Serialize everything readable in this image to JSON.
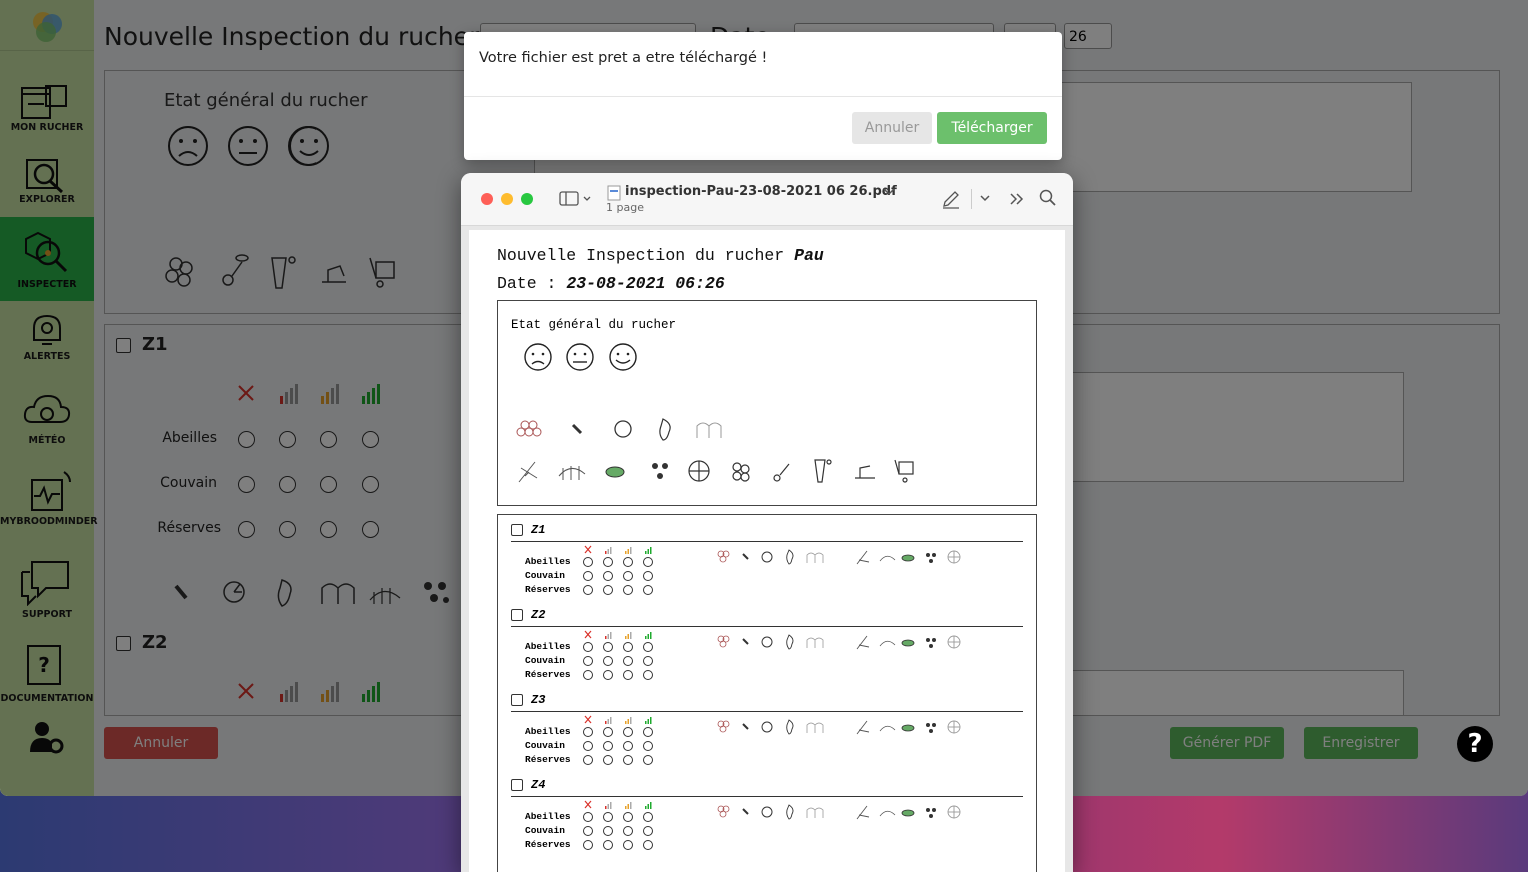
{
  "sidebar": {
    "items": [
      {
        "label": "MON RUCHER"
      },
      {
        "label": "EXPLORER"
      },
      {
        "label": "INSPECTER"
      },
      {
        "label": "ALERTES"
      },
      {
        "label": "MÉTÉO"
      },
      {
        "label": "MYBROODMINDER"
      },
      {
        "label": "SUPPORT"
      },
      {
        "label": "DOCUMENTATION"
      }
    ]
  },
  "header": {
    "title": "Nouvelle Inspection du rucher",
    "date_label": "Date",
    "minute_value": "26"
  },
  "etat": {
    "title": "Etat général du rucher"
  },
  "zones": [
    {
      "name": "Z1",
      "rows": [
        "Abeilles",
        "Couvain",
        "Réserves"
      ]
    },
    {
      "name": "Z2"
    }
  ],
  "footer": {
    "cancel": "Annuler",
    "generate_pdf": "Générer PDF",
    "save": "Enregistrer",
    "help": "?"
  },
  "modal": {
    "message": "Votre fichier est pret a etre téléchargé !",
    "cancel": "Annuler",
    "download": "Télécharger"
  },
  "pdf": {
    "filename": "inspection-Pau-23-08-2021 06 26.pdf",
    "pages": "1 page",
    "title_prefix": "Nouvelle Inspection du rucher",
    "apiary": "Pau",
    "date_prefix": "Date :",
    "date_value": "23-08-2021 06:26",
    "etat_title": "Etat général du rucher",
    "zones": [
      "Z1",
      "Z2",
      "Z3",
      "Z4"
    ],
    "rows": [
      "Abeilles",
      "Couvain",
      "Réserves"
    ]
  },
  "colors": {
    "sidebar": "#c8e2a4",
    "active": "#2ab44a",
    "danger": "#d9534f",
    "success": "#5cb85c",
    "strength_red": "#d9322b",
    "strength_orange": "#e6a02a",
    "strength_green": "#1faa2e"
  }
}
